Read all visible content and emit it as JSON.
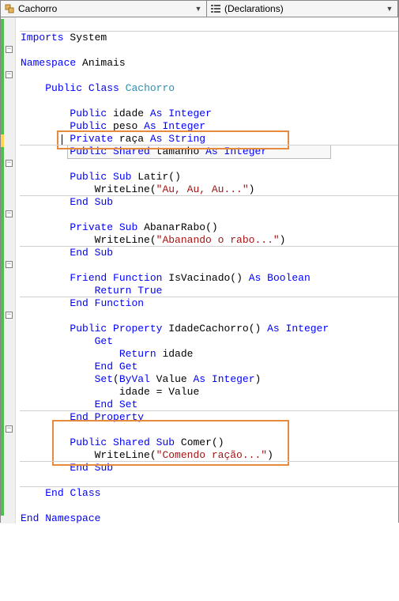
{
  "header": {
    "class_dropdown": "Cachorro",
    "member_dropdown": "(Declarations)"
  },
  "code": {
    "l1": {
      "imports": "Imports",
      "system": "System"
    },
    "l3": {
      "namespace": "Namespace",
      "name": "Animais"
    },
    "l5": {
      "public": "Public",
      "class": "Class",
      "name": "Cachorro"
    },
    "l7": {
      "public": "Public",
      "name": "idade",
      "as": "As",
      "type": "Integer"
    },
    "l8": {
      "public": "Public",
      "name": "peso",
      "as": "As",
      "type": "Integer"
    },
    "l9": {
      "private": "Private",
      "name": "raça",
      "as": "As",
      "type": "String"
    },
    "l10": {
      "public": "Public",
      "shared": "Shared",
      "name": "tamanho",
      "as": "As",
      "type": "Integer"
    },
    "l12": {
      "public": "Public",
      "sub": "Sub",
      "name": "Latir()"
    },
    "l13": {
      "call": "WriteLine(",
      "str": "\"Au, Au, Au...\"",
      "close": ")"
    },
    "l14": {
      "end": "End",
      "sub": "Sub"
    },
    "l16": {
      "private": "Private",
      "sub": "Sub",
      "name": "AbanarRabo()"
    },
    "l17": {
      "call": "WriteLine(",
      "str": "\"Abanando o rabo...\"",
      "close": ")"
    },
    "l18": {
      "end": "End",
      "sub": "Sub"
    },
    "l20": {
      "friend": "Friend",
      "function": "Function",
      "name": "IsVacinado()",
      "as": "As",
      "type": "Boolean"
    },
    "l21": {
      "return": "Return",
      "true": "True"
    },
    "l22": {
      "end": "End",
      "function": "Function"
    },
    "l24": {
      "public": "Public",
      "property": "Property",
      "name": "IdadeCachorro()",
      "as": "As",
      "type": "Integer"
    },
    "l25": {
      "get": "Get"
    },
    "l26": {
      "return": "Return",
      "name": "idade"
    },
    "l27": {
      "end": "End",
      "get": "Get"
    },
    "l28": {
      "set": "Set",
      "open": "(",
      "byval": "ByVal",
      "value": "Value",
      "as": "As",
      "type": "Integer",
      "close": ")"
    },
    "l29": {
      "text": "idade = Value"
    },
    "l30": {
      "end": "End",
      "set": "Set"
    },
    "l31": {
      "end": "End",
      "property": "Property"
    },
    "l33": {
      "public": "Public",
      "shared": "Shared",
      "sub": "Sub",
      "name": "Comer()"
    },
    "l34": {
      "call": "WriteLine(",
      "str": "\"Comendo ração...\"",
      "close": ")"
    },
    "l35": {
      "end": "End",
      "sub": "Sub"
    },
    "l37": {
      "end": "End",
      "class": "Class"
    },
    "l39": {
      "end": "End",
      "namespace": "Namespace"
    }
  }
}
